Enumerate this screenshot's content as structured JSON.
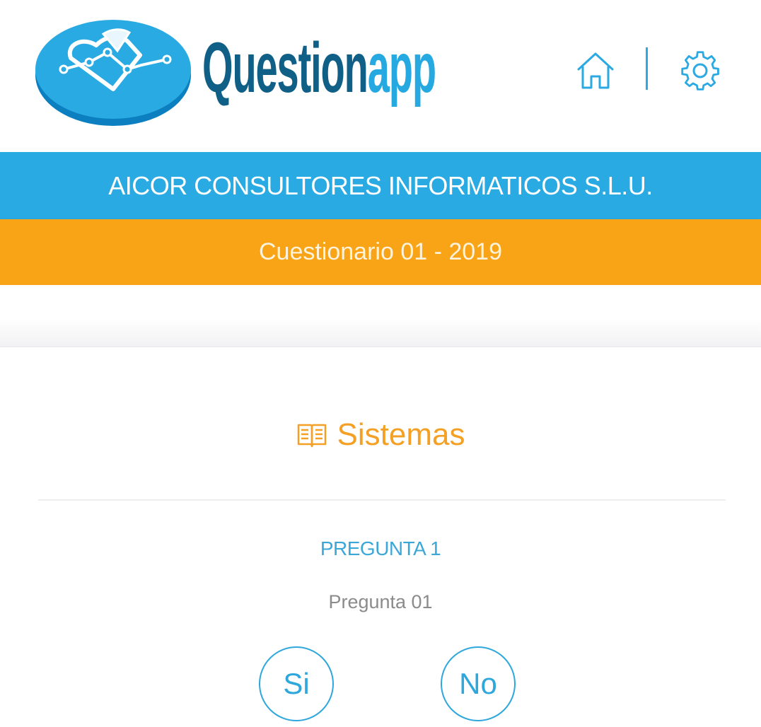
{
  "header": {
    "brand_part1": "Question",
    "brand_part2": "app",
    "home_icon": "home-icon",
    "settings_icon": "gear-icon"
  },
  "company": {
    "name": "AICOR CONSULTORES INFORMATICOS S.L.U."
  },
  "questionnaire": {
    "title": "Cuestionario 01 - 2019"
  },
  "section": {
    "icon": "book-icon",
    "title": "Sistemas"
  },
  "question": {
    "label": "PREGUNTA 1",
    "text": "Pregunta 01"
  },
  "answers": {
    "yes_label": "Si",
    "no_label": "No"
  },
  "colors": {
    "brand_dark": "#0f5f86",
    "brand_light": "#25a9e0",
    "company_bar": "#29aae2",
    "questionnaire_bar": "#f8a416",
    "section_accent": "#f4a024"
  }
}
